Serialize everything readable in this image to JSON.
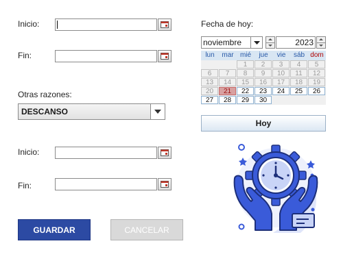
{
  "form": {
    "start_label": "Inicio:",
    "start_value": "",
    "end_label": "Fin:",
    "end_value": "",
    "other_reasons_label": "Otras razones:",
    "other_reasons_value": "DESCANSO",
    "start2_label": "Inicio:",
    "start2_value": "",
    "end2_label": "Fin:",
    "end2_value": ""
  },
  "buttons": {
    "save": "GUARDAR",
    "cancel": "CANCELAR"
  },
  "calendar": {
    "title": "Fecha de hoy:",
    "month": "noviembre",
    "year": "2023",
    "weekdays": [
      "lun",
      "mar",
      "mié",
      "jue",
      "vie",
      "sáb",
      "dom"
    ],
    "weeks": [
      [
        {
          "d": "",
          "t": "empty"
        },
        {
          "d": "",
          "t": "empty"
        },
        {
          "d": "1",
          "t": "prev"
        },
        {
          "d": "2",
          "t": "prev"
        },
        {
          "d": "3",
          "t": "prev"
        },
        {
          "d": "4",
          "t": "prev"
        },
        {
          "d": "5",
          "t": "prev"
        }
      ],
      [
        {
          "d": "6",
          "t": "prev"
        },
        {
          "d": "7",
          "t": "prev"
        },
        {
          "d": "8",
          "t": "prev"
        },
        {
          "d": "9",
          "t": "prev"
        },
        {
          "d": "10",
          "t": "prev"
        },
        {
          "d": "11",
          "t": "prev"
        },
        {
          "d": "12",
          "t": "prev"
        }
      ],
      [
        {
          "d": "13",
          "t": "prev"
        },
        {
          "d": "14",
          "t": "prev"
        },
        {
          "d": "15",
          "t": "prev"
        },
        {
          "d": "16",
          "t": "prev"
        },
        {
          "d": "17",
          "t": "prev"
        },
        {
          "d": "18",
          "t": "prev"
        },
        {
          "d": "19",
          "t": "prev"
        }
      ],
      [
        {
          "d": "20",
          "t": "prev"
        },
        {
          "d": "21",
          "t": "today"
        },
        {
          "d": "22",
          "t": "cur"
        },
        {
          "d": "23",
          "t": "cur"
        },
        {
          "d": "24",
          "t": "cur"
        },
        {
          "d": "25",
          "t": "cur"
        },
        {
          "d": "26",
          "t": "cur"
        }
      ],
      [
        {
          "d": "27",
          "t": "cur"
        },
        {
          "d": "28",
          "t": "cur"
        },
        {
          "d": "29",
          "t": "cur"
        },
        {
          "d": "30",
          "t": "cur"
        },
        {
          "d": "",
          "t": "empty"
        },
        {
          "d": "",
          "t": "empty"
        },
        {
          "d": "",
          "t": "empty"
        }
      ]
    ],
    "today_button": "Hoy"
  },
  "colors": {
    "save_bg": "#2c4aa3",
    "illustration_blue": "#3a5bd9",
    "illustration_light": "#c9d4f7",
    "today_highlight": "#d8a0a0"
  },
  "icons": {
    "date_picker": "calendar-icon",
    "illustration": "clock-gear-hands-illustration"
  }
}
